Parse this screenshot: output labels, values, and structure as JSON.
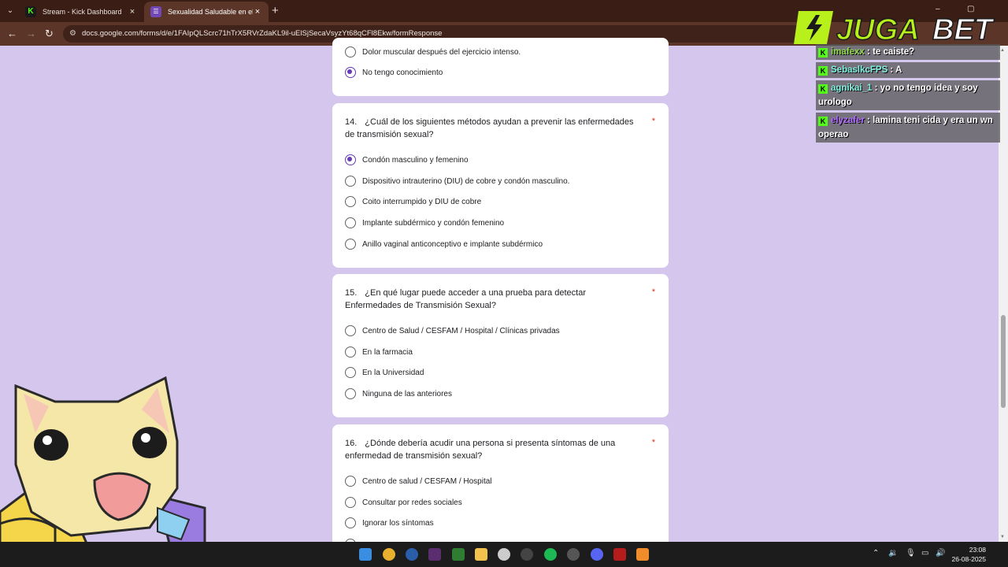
{
  "browser": {
    "tabs": [
      {
        "favicon": "kick-icon",
        "title": "Stream - Kick Dashboard",
        "close": "×"
      },
      {
        "favicon": "google-forms-icon",
        "title": "Sexualidad Saludable en el adu",
        "close": "×"
      }
    ],
    "new_tab": "+",
    "url": "docs.google.com/forms/d/e/1FAIpQLScrc71hTrX5RVrZdaKL9il-uElSjSecaVsyzYt68qCFl8Ekw/formResponse",
    "nav": {
      "back": "←",
      "forward": "→",
      "reload": "↻"
    },
    "window_controls": {
      "minimize": "–",
      "maximize": "▢"
    }
  },
  "form": {
    "q13_partial": {
      "options": [
        {
          "label": "Dolor muscular después del ejercicio intenso.",
          "selected": false
        },
        {
          "label": "No tengo conocimiento",
          "selected": true
        }
      ]
    },
    "questions": [
      {
        "number": "14.",
        "text": "¿Cuál de los siguientes métodos ayudan a prevenir las enfermedades de transmisión sexual?",
        "required_mark": "*",
        "options": [
          {
            "label": "Condón masculino y femenino",
            "selected": true
          },
          {
            "label": "Dispositivo intrauterino (DIU) de cobre y condón masculino.",
            "selected": false
          },
          {
            "label": "Coito interrumpido y DIU de cobre",
            "selected": false
          },
          {
            "label": "Implante subdérmico y condón femenino",
            "selected": false
          },
          {
            "label": "Anillo vaginal anticonceptivo e implante subdérmico",
            "selected": false
          }
        ]
      },
      {
        "number": "15.",
        "text": "¿En qué lugar puede acceder a una prueba para detectar Enfermedades de Transmisión Sexual?",
        "required_mark": "*",
        "options": [
          {
            "label": "Centro de Salud / CESFAM / Hospital / Clínicas privadas",
            "selected": false
          },
          {
            "label": "En la farmacia",
            "selected": false
          },
          {
            "label": "En la Universidad",
            "selected": false
          },
          {
            "label": "Ninguna de las anteriores",
            "selected": false
          }
        ]
      },
      {
        "number": "16.",
        "text": "¿Dónde debería acudir una persona si presenta síntomas de una enfermedad de transmisión sexual?",
        "required_mark": "*",
        "options": [
          {
            "label": "Centro de salud / CESFAM / Hospital",
            "selected": false
          },
          {
            "label": "Consultar por redes sociales",
            "selected": false
          },
          {
            "label": "Ignorar los síntomas",
            "selected": false
          }
        ]
      }
    ]
  },
  "chat": [
    {
      "user": "imafexx",
      "sep": " : ",
      "text": "te caiste?",
      "color": "#8fd84a"
    },
    {
      "user": "SebaslkcFPS",
      "sep": " : ",
      "text": "A",
      "color": "#7ff3e0"
    },
    {
      "user": "agnikai_1",
      "sep": " : ",
      "text": "yo no tengo idea y soy urologo",
      "color": "#7ff3e0"
    },
    {
      "user": "elyzafer",
      "sep": " : ",
      "text": "lamina teni cida y era un wn operao",
      "color": "#b06cff"
    }
  ],
  "logo": {
    "text_a": "JUGA",
    "text_b": "BET"
  },
  "taskbar": {
    "time": "23:08",
    "date": "26-08-2025"
  },
  "colors": {
    "accent": "#673ab7",
    "background": "#d5c6ee",
    "kick_green": "#53fc18",
    "required": "#d93025"
  }
}
